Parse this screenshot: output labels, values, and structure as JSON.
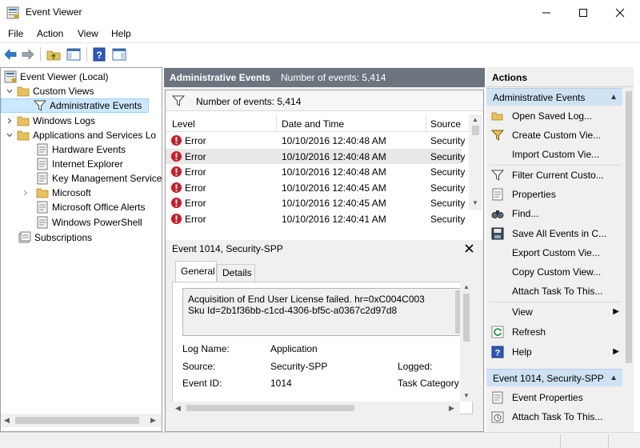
{
  "window": {
    "title": "Event Viewer"
  },
  "menu": {
    "items": [
      "File",
      "Action",
      "View",
      "Help"
    ]
  },
  "tree": {
    "root": "Event Viewer (Local)",
    "custom_views": "Custom Views",
    "administrative_events": "Administrative Events",
    "windows_logs": "Windows Logs",
    "apps_services": "Applications and Services Lo",
    "hardware_events": "Hardware Events",
    "internet_explorer": "Internet Explorer",
    "key_management": "Key Management Service",
    "microsoft": "Microsoft",
    "office_alerts": "Microsoft Office Alerts",
    "powershell": "Windows PowerShell",
    "subscriptions": "Subscriptions"
  },
  "center": {
    "header_title": "Administrative Events",
    "header_count": "Number of events: 5,414",
    "filter_count": "Number of events: 5,414",
    "columns": {
      "level": "Level",
      "datetime": "Date and Time",
      "source": "Source"
    },
    "rows": [
      {
        "level": "Error",
        "datetime": "10/10/2016 12:40:48 AM",
        "source": "Security"
      },
      {
        "level": "Error",
        "datetime": "10/10/2016 12:40:48 AM",
        "source": "Security"
      },
      {
        "level": "Error",
        "datetime": "10/10/2016 12:40:48 AM",
        "source": "Security"
      },
      {
        "level": "Error",
        "datetime": "10/10/2016 12:40:45 AM",
        "source": "Security"
      },
      {
        "level": "Error",
        "datetime": "10/10/2016 12:40:45 AM",
        "source": "Security"
      },
      {
        "level": "Error",
        "datetime": "10/10/2016 12:40:41 AM",
        "source": "Security"
      }
    ]
  },
  "detail": {
    "title": "Event 1014, Security-SPP",
    "tabs": {
      "general": "General",
      "details": "Details"
    },
    "message_line1": "Acquisition of End User License failed. hr=0xC004C003",
    "message_line2": "Sku Id=2b1f36bb-c1cd-4306-bf5c-a0367c2d97d8",
    "log_name_label": "Log Name:",
    "log_name_value": "Application",
    "source_label": "Source:",
    "source_value": "Security-SPP",
    "logged_label": "Logged:",
    "event_id_label": "Event ID:",
    "event_id_value": "1014",
    "task_category_label": "Task Category"
  },
  "actions": {
    "header": "Actions",
    "section1_title": "Administrative Events",
    "section1_items": [
      {
        "label": "Open Saved Log...",
        "icon": "folder-open-icon"
      },
      {
        "label": "Create Custom Vie...",
        "icon": "filter-icon"
      },
      {
        "label": "Import Custom Vie...",
        "icon": "blank-icon"
      },
      {
        "label": "Filter Current Custo...",
        "icon": "filter-icon"
      },
      {
        "label": "Properties",
        "icon": "properties-icon"
      },
      {
        "label": "Find...",
        "icon": "binoculars-icon"
      },
      {
        "label": "Save All Events in C...",
        "icon": "save-icon"
      },
      {
        "label": "Export Custom Vie...",
        "icon": "blank-icon"
      },
      {
        "label": "Copy Custom View...",
        "icon": "blank-icon"
      },
      {
        "label": "Attach Task To This...",
        "icon": "blank-icon"
      },
      {
        "label": "View",
        "icon": "blank-icon",
        "submenu": true
      },
      {
        "label": "Refresh",
        "icon": "refresh-icon"
      },
      {
        "label": "Help",
        "icon": "help-icon",
        "submenu": true
      }
    ],
    "section2_title": "Event 1014, Security-SPP",
    "section2_items": [
      {
        "label": "Event Properties",
        "icon": "properties-icon"
      },
      {
        "label": "Attach Task To This...",
        "icon": "task-icon"
      }
    ]
  }
}
